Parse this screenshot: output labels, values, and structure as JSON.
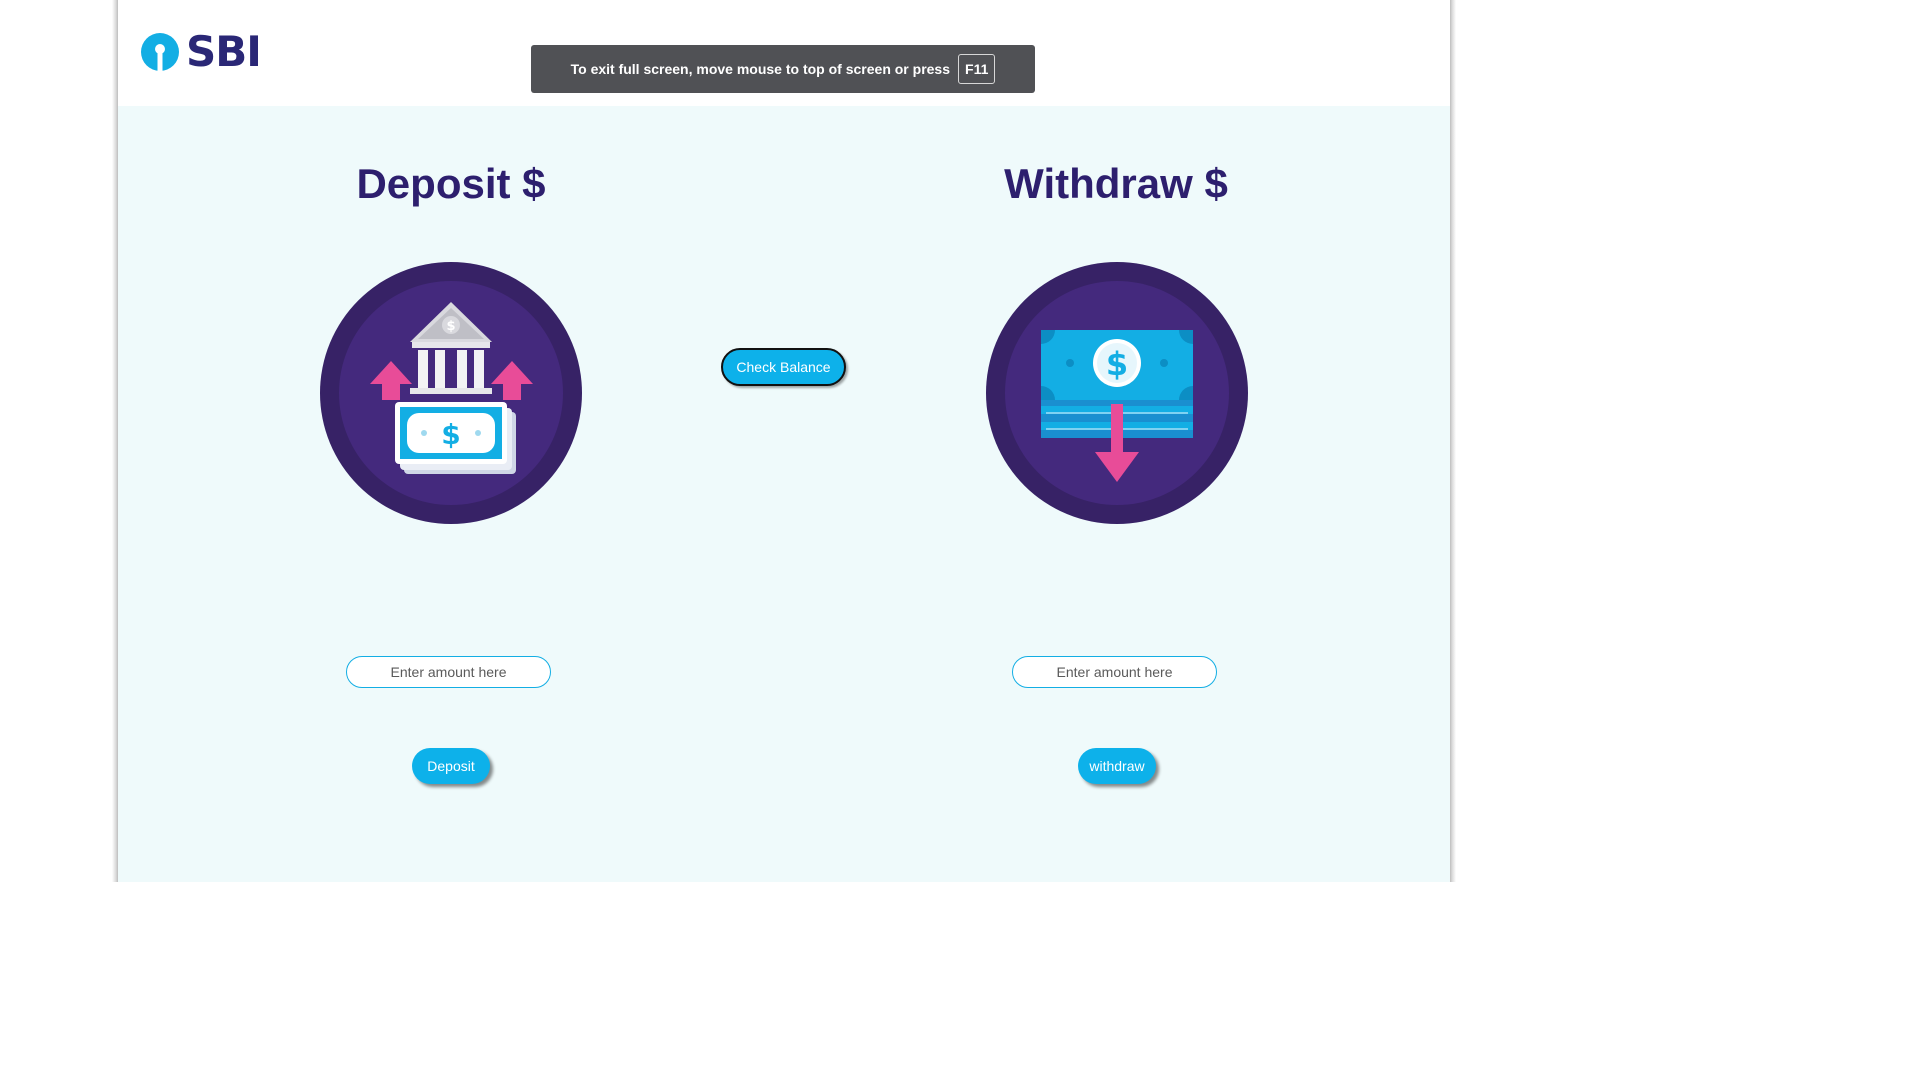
{
  "brand": {
    "name": "SBI",
    "colors": {
      "navy": "#2a2776",
      "cyan": "#13aee4",
      "purple": "#3b2770",
      "pink": "#e84c98",
      "background": "#effafb"
    }
  },
  "fullscreen_notice": {
    "message": "To exit full screen, move mouse to top of screen or press",
    "key": "F11"
  },
  "deposit": {
    "title": "Deposit $",
    "icon": "bank-deposit-icon",
    "amount_placeholder": "Enter amount here",
    "button_label": "Deposit"
  },
  "withdraw": {
    "title": "Withdraw $",
    "icon": "cash-withdraw-icon",
    "amount_placeholder": "Enter amount here",
    "button_label": "withdraw"
  },
  "check_balance": {
    "button_label": "Check Balance"
  }
}
